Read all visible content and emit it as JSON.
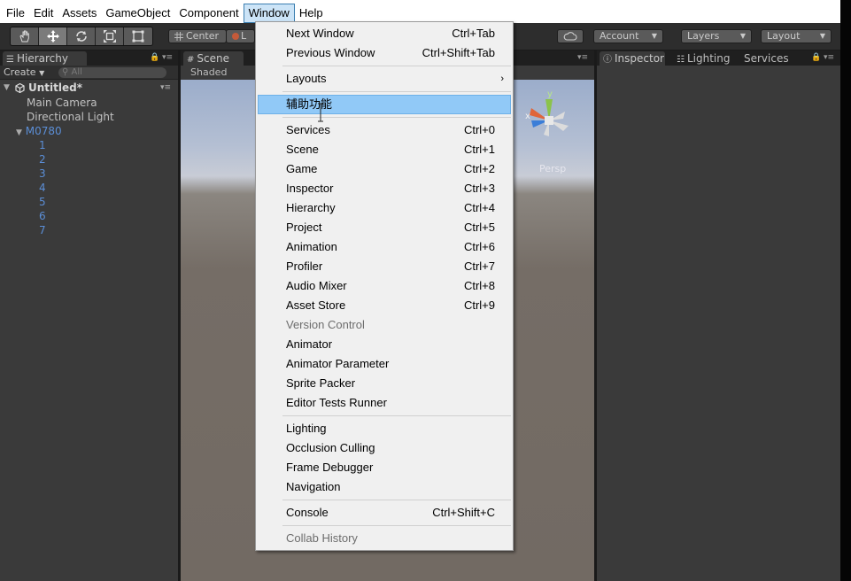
{
  "menubar": {
    "items": [
      "File",
      "Edit",
      "Assets",
      "GameObject",
      "Component",
      "Window",
      "Help"
    ],
    "open_item": "Window"
  },
  "toolbar": {
    "tools": [
      "hand-icon",
      "move-icon",
      "rotate-icon",
      "scale-icon",
      "rect-tool-icon"
    ],
    "pivot_mode": "Center",
    "pivot_rotation_partial": "L",
    "account": "Account",
    "layers": "Layers",
    "layout": "Layout",
    "cloud_icon": "cloud-icon"
  },
  "hierarchy": {
    "tab_label": "Hierarchy",
    "create_label": "Create",
    "search_placeholder": "All",
    "scene_name": "Untitled*",
    "items": [
      "Main Camera",
      "Directional Light"
    ],
    "group_name": "M0780",
    "children": [
      "1",
      "2",
      "3",
      "4",
      "5",
      "6",
      "7"
    ]
  },
  "scene": {
    "tab_label": "Scene",
    "shading_mode": "Shaded",
    "projection": "Persp",
    "gizmo_y": "y",
    "gizmo_x": "x",
    "colors": {
      "sky": "#96a9c9",
      "ground": "#726a63"
    }
  },
  "inspector": {
    "tabs": [
      "Inspector",
      "Lighting",
      "Services"
    ]
  },
  "window_menu": {
    "items": [
      {
        "label": "Next Window",
        "shortcut": "Ctrl+Tab"
      },
      {
        "label": "Previous Window",
        "shortcut": "Ctrl+Shift+Tab"
      },
      {
        "label": "Layouts",
        "shortcut": ""
      },
      {
        "label": "辅助功能",
        "shortcut": ""
      },
      {
        "label": "Services",
        "shortcut": "Ctrl+0"
      },
      {
        "label": "Scene",
        "shortcut": "Ctrl+1"
      },
      {
        "label": "Game",
        "shortcut": "Ctrl+2"
      },
      {
        "label": "Inspector",
        "shortcut": "Ctrl+3"
      },
      {
        "label": "Hierarchy",
        "shortcut": "Ctrl+4"
      },
      {
        "label": "Project",
        "shortcut": "Ctrl+5"
      },
      {
        "label": "Animation",
        "shortcut": "Ctrl+6"
      },
      {
        "label": "Profiler",
        "shortcut": "Ctrl+7"
      },
      {
        "label": "Audio Mixer",
        "shortcut": "Ctrl+8"
      },
      {
        "label": "Asset Store",
        "shortcut": "Ctrl+9"
      },
      {
        "label": "Version Control",
        "shortcut": ""
      },
      {
        "label": "Animator",
        "shortcut": ""
      },
      {
        "label": "Animator Parameter",
        "shortcut": ""
      },
      {
        "label": "Sprite Packer",
        "shortcut": ""
      },
      {
        "label": "Editor Tests Runner",
        "shortcut": ""
      },
      {
        "label": "Lighting",
        "shortcut": ""
      },
      {
        "label": "Occlusion Culling",
        "shortcut": ""
      },
      {
        "label": "Frame Debugger",
        "shortcut": ""
      },
      {
        "label": "Navigation",
        "shortcut": ""
      },
      {
        "label": "Console",
        "shortcut": "Ctrl+Shift+C"
      },
      {
        "label": "Collab History",
        "shortcut": ""
      }
    ],
    "highlighted": "辅助功能",
    "disabled": [
      "Version Control",
      "Collab History"
    ],
    "submenu": [
      "Layouts"
    ]
  }
}
